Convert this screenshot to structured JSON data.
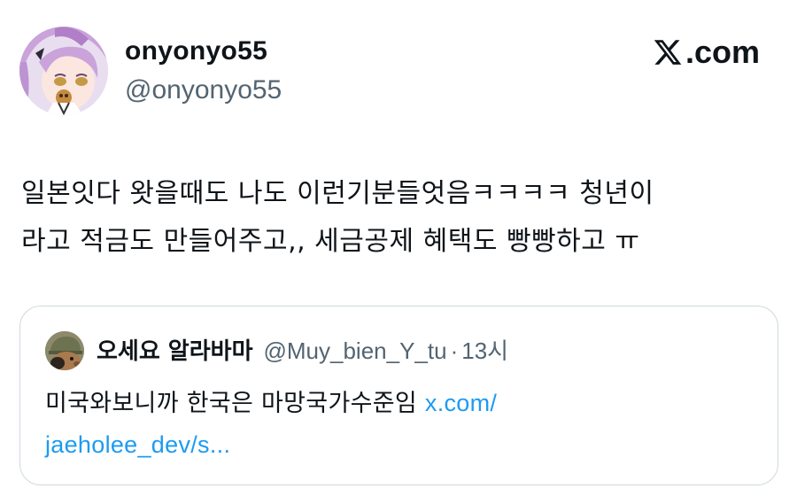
{
  "author": {
    "display_name": "onyonyo55",
    "handle": "@onyonyo55"
  },
  "brand": {
    "text": ".com",
    "icon": "x-logo-icon"
  },
  "body": {
    "line1": "일본잇다 왓을때도 나도 이런기분들엇음ㅋㅋㅋㅋ 청년이",
    "line2": "라고 적금도 만들어주고,, 세금공제 혜택도 빵빵하고 ㅠ"
  },
  "quoted_tweet": {
    "display_name": "오세요 알라바마",
    "handle": "@Muy_bien_Y_tu",
    "separator": "·",
    "time": "13시",
    "text": "미국와보니까 한국은 마망국가수준임 ",
    "link_part1": "x.com/",
    "link_part2": "jaeholee_dev/s..."
  },
  "colors": {
    "text_primary": "#0f1419",
    "text_secondary": "#536471",
    "link": "#1d9bf0",
    "border": "#cfd9de"
  }
}
